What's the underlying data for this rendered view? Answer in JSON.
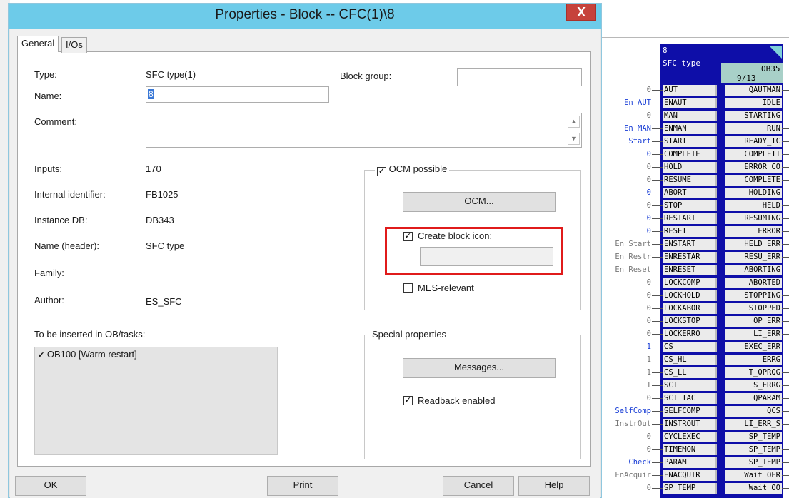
{
  "dialog": {
    "title": "Properties - Block -- CFC(1)\\8",
    "close_glyph": "X",
    "tabs": [
      {
        "label": "General",
        "active": true
      },
      {
        "label": "I/Os",
        "active": false
      }
    ]
  },
  "general": {
    "type_label": "Type:",
    "type_value": "SFC type(1)",
    "name_label": "Name:",
    "name_value": "8",
    "block_group_label": "Block group:",
    "block_group_value": "",
    "comment_label": "Comment:",
    "comment_value": "",
    "inputs_label": "Inputs:",
    "inputs_value": "170",
    "internal_id_label": "Internal identifier:",
    "internal_id_value": "FB1025",
    "instance_db_label": "Instance DB:",
    "instance_db_value": "DB343",
    "name_header_label": "Name (header):",
    "name_header_value": "SFC type",
    "family_label": "Family:",
    "family_value": "",
    "author_label": "Author:",
    "author_value": "ES_SFC",
    "ob_tasks_label": "To be inserted in OB/tasks:",
    "ob_tasks": [
      "OB100 [Warm restart]"
    ]
  },
  "ocm_group": {
    "ocm_possible_label": "OCM possible",
    "ocm_possible_checked": true,
    "ocm_button": "OCM...",
    "create_icon_label": "Create block icon:",
    "create_icon_checked": true,
    "create_icon_value": "",
    "mes_label": "MES-relevant",
    "mes_checked": false
  },
  "special": {
    "caption": "Special properties",
    "messages_button": "Messages...",
    "readback_label": "Readback enabled",
    "readback_checked": true
  },
  "buttons": {
    "ok": "OK",
    "print": "Print",
    "cancel": "Cancel",
    "help": "Help"
  },
  "cfc_block": {
    "number": "8",
    "type": "SFC type",
    "ob": "OB35",
    "sort": "9/13",
    "colors": {
      "block": "#0e0ea8",
      "pin": "#ebebeb",
      "value_blue": "#1a3fd6",
      "value_gray": "#777777"
    },
    "inputs": [
      {
        "value": "0",
        "name": "AUT",
        "blue": false
      },
      {
        "value": "En AUT",
        "name": "ENAUT",
        "blue": true
      },
      {
        "value": "0",
        "name": "MAN",
        "blue": false
      },
      {
        "value": "En MAN",
        "name": "ENMAN",
        "blue": true
      },
      {
        "value": "Start",
        "name": "START",
        "blue": true
      },
      {
        "value": "0",
        "name": "COMPLETE",
        "blue": true
      },
      {
        "value": "0",
        "name": "HOLD",
        "blue": false
      },
      {
        "value": "0",
        "name": "RESUME",
        "blue": false
      },
      {
        "value": "0",
        "name": "ABORT",
        "blue": true
      },
      {
        "value": "0",
        "name": "STOP",
        "blue": false
      },
      {
        "value": "0",
        "name": "RESTART",
        "blue": true
      },
      {
        "value": "0",
        "name": "RESET",
        "blue": true
      },
      {
        "value": "En Start",
        "name": "ENSTART",
        "blue": false
      },
      {
        "value": "En Restr",
        "name": "ENRESTAR",
        "blue": false
      },
      {
        "value": "En Reset",
        "name": "ENRESET",
        "blue": false
      },
      {
        "value": "0",
        "name": "LOCKCOMP",
        "blue": false
      },
      {
        "value": "0",
        "name": "LOCKHOLD",
        "blue": false
      },
      {
        "value": "0",
        "name": "LOCKABOR",
        "blue": false
      },
      {
        "value": "0",
        "name": "LOCKSTOP",
        "blue": false
      },
      {
        "value": "0",
        "name": "LOCKERRO",
        "blue": false
      },
      {
        "value": "1",
        "name": "CS",
        "blue": true
      },
      {
        "value": "1",
        "name": "CS_HL",
        "blue": false
      },
      {
        "value": "1",
        "name": "CS_LL",
        "blue": false
      },
      {
        "value": "T",
        "name": "SCT",
        "blue": false
      },
      {
        "value": "0",
        "name": "SCT_TAC",
        "blue": false
      },
      {
        "value": "SelfComp",
        "name": "SELFCOMP",
        "blue": true
      },
      {
        "value": "InstrOut",
        "name": "INSTROUT",
        "blue": false
      },
      {
        "value": "0",
        "name": "CYCLEXEC",
        "blue": false
      },
      {
        "value": "0",
        "name": "TIMEMON",
        "blue": false
      },
      {
        "value": "Check",
        "name": "PARAM",
        "blue": true
      },
      {
        "value": "EnAcquir",
        "name": "ENACQUIR",
        "blue": false
      },
      {
        "value": "0",
        "name": "SP_TEMP",
        "blue": false
      }
    ],
    "outputs": [
      "QAUTMAN",
      "IDLE",
      "STARTING",
      "RUN",
      "READY_TC",
      "COMPLETI",
      "ERROR_CO",
      "COMPLETE",
      "HOLDING",
      "HELD",
      "RESUMING",
      "ERROR",
      "HELD_ERR",
      "RESU_ERR",
      "ABORTING",
      "ABORTED",
      "STOPPING",
      "STOPPED",
      "OP_ERR",
      "LI_ERR",
      "EXEC_ERR",
      "ERRG",
      "T_OPRQG",
      "S_ERRG",
      "QPARAM",
      "QCS",
      "LI_ERR_S",
      "SP_TEMP",
      "SP_TEMP",
      "SP_TEMP",
      "Wait_OER",
      "Wait_OO"
    ]
  }
}
